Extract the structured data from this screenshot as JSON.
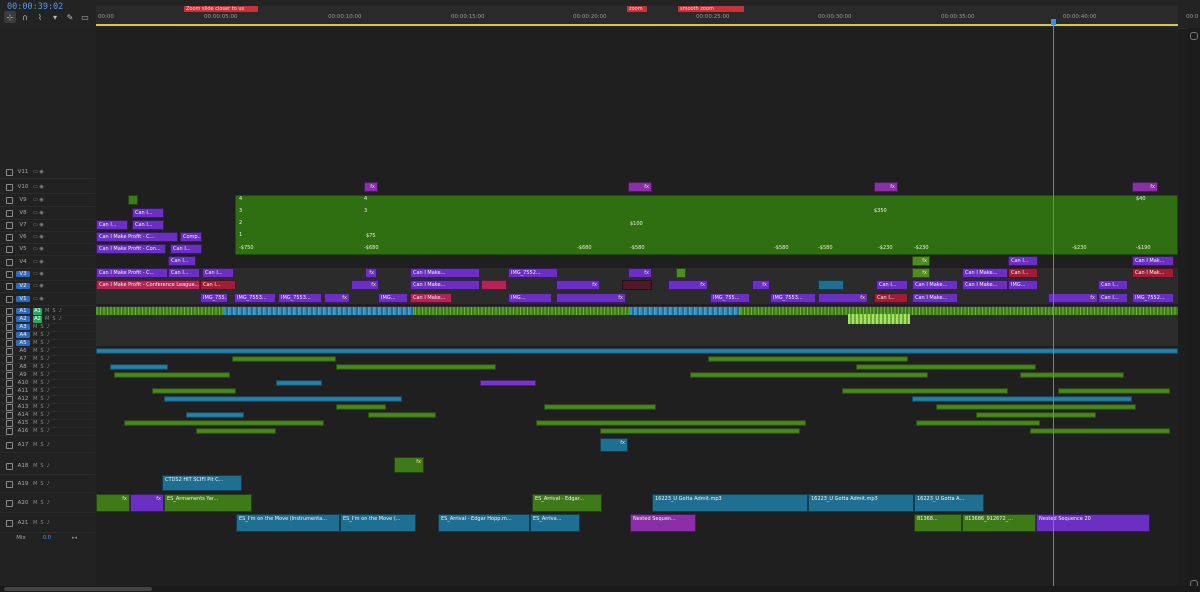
{
  "timecode": "00:00:39:02",
  "ruler": {
    "labels": [
      "00:00",
      "00:00:05:00",
      "00:00:10:00",
      "00:00:15:00",
      "00:00:20:00",
      "00:00:25:00",
      "00:00:30:00",
      "00:00:35:00",
      "00:00:40:00"
    ],
    "end_label": "00:0",
    "markers": [
      "Zoom slide closer to us",
      "zoom",
      "smooth zoom"
    ]
  },
  "tools": [
    "select-icon",
    "track-select-icon",
    "ripple-icon",
    "marker-icon",
    "wrench-icon",
    "captions-icon"
  ],
  "tracks": {
    "video": [
      "V11",
      "V10",
      "V9",
      "V8",
      "V7",
      "V6",
      "V5",
      "V4",
      "V3",
      "V2",
      "V1"
    ],
    "audio": [
      "A1",
      "A2",
      "A3",
      "A4",
      "A5",
      "A6",
      "A7",
      "A8",
      "A9",
      "A10",
      "A11",
      "A12",
      "A13",
      "A14",
      "A15",
      "A16",
      "A17",
      "A18",
      "A19",
      "A20",
      "A21"
    ],
    "source_labels": [
      "V1",
      "A1",
      "A2"
    ],
    "mute": "M",
    "solo": "S",
    "mix_label": "Mix",
    "mix_value": "0.0"
  },
  "clips": {
    "nest_labels": [
      "4",
      "3",
      "2",
      "1"
    ],
    "v9_values": [
      "4",
      "$350",
      "$40"
    ],
    "v8_values": [
      "3"
    ],
    "v7_values": [
      "$100"
    ],
    "v6_values": [
      "$75"
    ],
    "v5_values": [
      "-$750",
      "-$680",
      "-$680",
      "-$580",
      "-$580",
      "-$580",
      "-$230",
      "-$230",
      "-$230",
      "-$190"
    ],
    "fx": "fx",
    "can_i_short": "Can I...",
    "can_i_make": "Can I Make...",
    "can_i_profit": "Can I Make Profit - C...",
    "can_i_profit_con": "Can I Make Profit - Con...",
    "conference": "Can I Make Profit - Conference League...",
    "comp": "Comp...",
    "img_7552": "IMG_7552...",
    "img_755": "IMG_755...",
    "img_7553": "IMG_7553...",
    "img_short": "IMG...",
    "can_i_mak": "Can I Mak...",
    "a19": "CTDS2 HIT SCIFI Pit C...",
    "a20": [
      "ES_Armaments Yar...",
      "ES_Arrival - Edgar...",
      "16223_U Gotta Admit.mp3",
      "16223_U Gotta Admit.mp3",
      "16223_U Gotta A..."
    ],
    "a21": [
      "ES_I'm on the Move (Instrumenta...",
      "ES_I'm on the Move (...",
      "ES_Arrival - Edgar Hopp.m...",
      "ES_Arriva...",
      "Nested Sequen...",
      "81368...",
      "813686_912672_...",
      "Nested Sequence 20"
    ]
  }
}
